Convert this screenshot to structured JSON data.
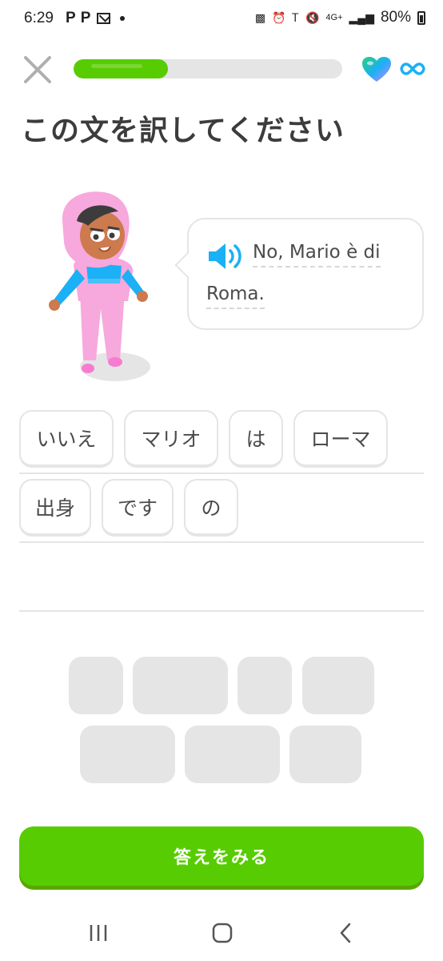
{
  "status_bar": {
    "time": "6:29",
    "left_icons": [
      "P",
      "P"
    ],
    "network": "4G+",
    "battery_percent": "80%"
  },
  "header": {
    "progress_fraction": 0.35,
    "progress_color": "#58cc02",
    "close_icon": "close-x-icon",
    "hearts_icon": "gradient-heart-icon",
    "hearts_value_icon": "infinity-icon"
  },
  "title": "この文を訳してください",
  "prompt": {
    "line1": "No, Mario è di",
    "line2": "Roma.",
    "speaker_icon": "speaker-icon"
  },
  "answer_tiles": [
    {
      "label": "いいえ"
    },
    {
      "label": "マリオ"
    },
    {
      "label": "は"
    },
    {
      "label": "ローマ"
    },
    {
      "label": "出身"
    },
    {
      "label": "です"
    },
    {
      "label": "の"
    }
  ],
  "bank_slots_count": 7,
  "check_button": "答えをみる",
  "nav": [
    "recent-apps-icon",
    "home-icon",
    "back-icon"
  ],
  "colors": {
    "accent_green": "#58cc02",
    "tile_border": "#e5e5e5",
    "speaker_blue": "#1cb0f6"
  }
}
